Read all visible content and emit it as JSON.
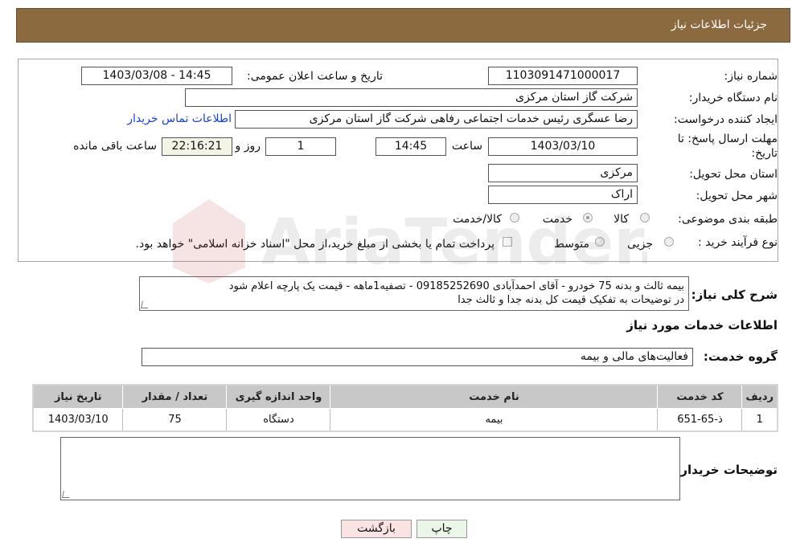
{
  "header": {
    "title": "جزئیات اطلاعات نیاز"
  },
  "form": {
    "need_number_label": "شماره نیاز:",
    "need_number": "1103091471000017",
    "announce_label": "تاریخ و ساعت اعلان عمومی:",
    "announce_value": "1403/03/08 - 14:45",
    "buyer_org_label": "نام دستگاه خریدار:",
    "buyer_org": "شرکت گاز استان مرکزی",
    "requester_label": "ایجاد کننده درخواست:",
    "requester": "رضا عسگری رئیس خدمات اجتماعی رفاهی شرکت گاز استان مرکزی",
    "contact_link": "اطلاعات تماس خریدار",
    "deadline_label_1": "مهلت ارسال پاسخ: تا",
    "deadline_label_2": "تاریخ:",
    "deadline_date": "1403/03/10",
    "time_label": "ساعت",
    "deadline_time": "14:45",
    "days_value": "1",
    "days_label": "روز و",
    "remaining_time": "22:16:21",
    "remaining_label": "ساعت باقی مانده",
    "province_label": "استان محل تحویل:",
    "province": "مرکزی",
    "city_label": "شهر محل تحویل:",
    "city": "اراک",
    "category_label": "طبقه بندی موضوعی:",
    "category_options": [
      "کالا",
      "خدمت",
      "کالا/خدمت"
    ],
    "category_selected": "خدمت",
    "purchase_type_label": "نوع فرآیند خرید :",
    "purchase_options": [
      "جزیی",
      "متوسط"
    ],
    "payment_note": "پرداخت تمام یا بخشی از مبلغ خرید،از محل \"اسناد خزانه اسلامی\" خواهد بود."
  },
  "description": {
    "label": "شرح کلی نیاز:",
    "line1": "بیمه ثالث و بدنه 75 خودرو - آقای احمدآبادی 09185252690 - تصفیه1ماهه - قیمت یک پارچه اعلام شود",
    "line2": "در توضیحات به تفکیک قیمت کل بدنه جدا و ثالث جدا"
  },
  "services": {
    "section_title": "اطلاعات خدمات مورد نیاز",
    "group_label": "گروه خدمت:",
    "group_value": "فعالیت‌های مالی و بیمه",
    "columns": [
      "ردیف",
      "کد خدمت",
      "نام خدمت",
      "واحد اندازه گیری",
      "تعداد / مقدار",
      "تاریخ نیاز"
    ],
    "rows": [
      [
        "1",
        "ذ-65-651",
        "بیمه",
        "دستگاه",
        "75",
        "1403/03/10"
      ]
    ]
  },
  "buyer_notes": {
    "label": "توضیحات خریدار:",
    "value": ""
  },
  "buttons": {
    "print": "چاپ",
    "back": "بازگشت"
  },
  "watermark": {
    "text": "AriaTender.net"
  },
  "colors": {
    "header_bg": "#8b6a40",
    "link": "#1a3fd6",
    "table_header": "#c8c8c8",
    "back_button": "#fbe3e3",
    "print_button": "#eaf7e6"
  }
}
